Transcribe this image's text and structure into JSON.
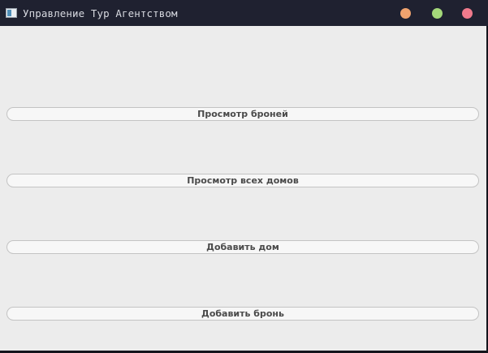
{
  "window": {
    "title": "Управление Тур Агентством",
    "controls": {
      "minimize_color": "#f0a36e",
      "maximize_color": "#a4d87a",
      "close_color": "#f07a8c"
    }
  },
  "main": {
    "buttons": [
      {
        "label": "Просмотр броней"
      },
      {
        "label": "Просмотр всех домов"
      },
      {
        "label": "Добавить дом"
      },
      {
        "label": "Добавить бронь"
      }
    ]
  },
  "colors": {
    "titlebar_bg": "#1f2130",
    "content_bg": "#ececec",
    "button_border": "#c3c3c3"
  }
}
